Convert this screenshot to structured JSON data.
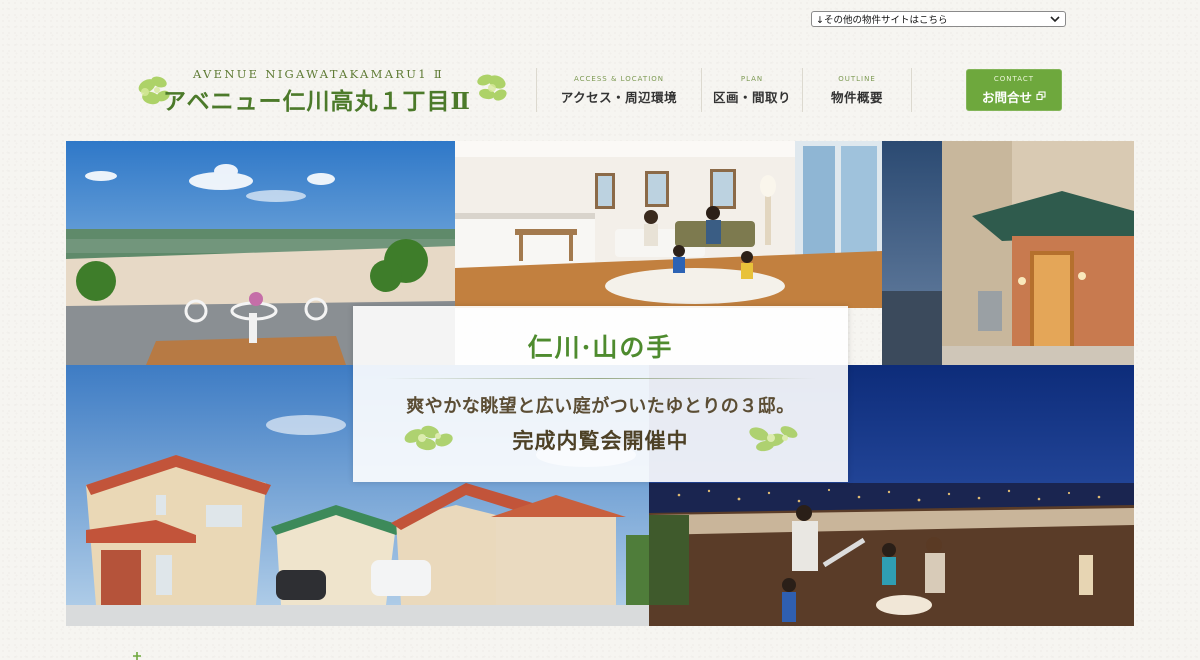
{
  "site_select": {
    "selected": "↓その他の物件サイトはこちら"
  },
  "logo": {
    "en": "AVENUE NIGAWATAKAMARU1 Ⅱ",
    "jp": "アベニュー仁川高丸１丁目Ⅱ"
  },
  "nav": {
    "items": [
      {
        "en": "ACCESS & LOCATION",
        "jp": "アクセス・周辺環境"
      },
      {
        "en": "PLAN",
        "jp": "区画・間取り"
      },
      {
        "en": "OUTLINE",
        "jp": "物件概要"
      }
    ],
    "contact": {
      "en": "CONTACT",
      "jp": "お問合せ",
      "icon": "external-window-icon"
    }
  },
  "hero": {
    "area": "仁川·山の手",
    "tagline": "爽やかな眺望と広い庭がついたゆとりの３邸。",
    "event": "完成内覧会開催中"
  },
  "colors": {
    "accent_green": "#6ea83d",
    "logo_green": "#4c7a2a",
    "caption_green": "#4e8b2e"
  }
}
